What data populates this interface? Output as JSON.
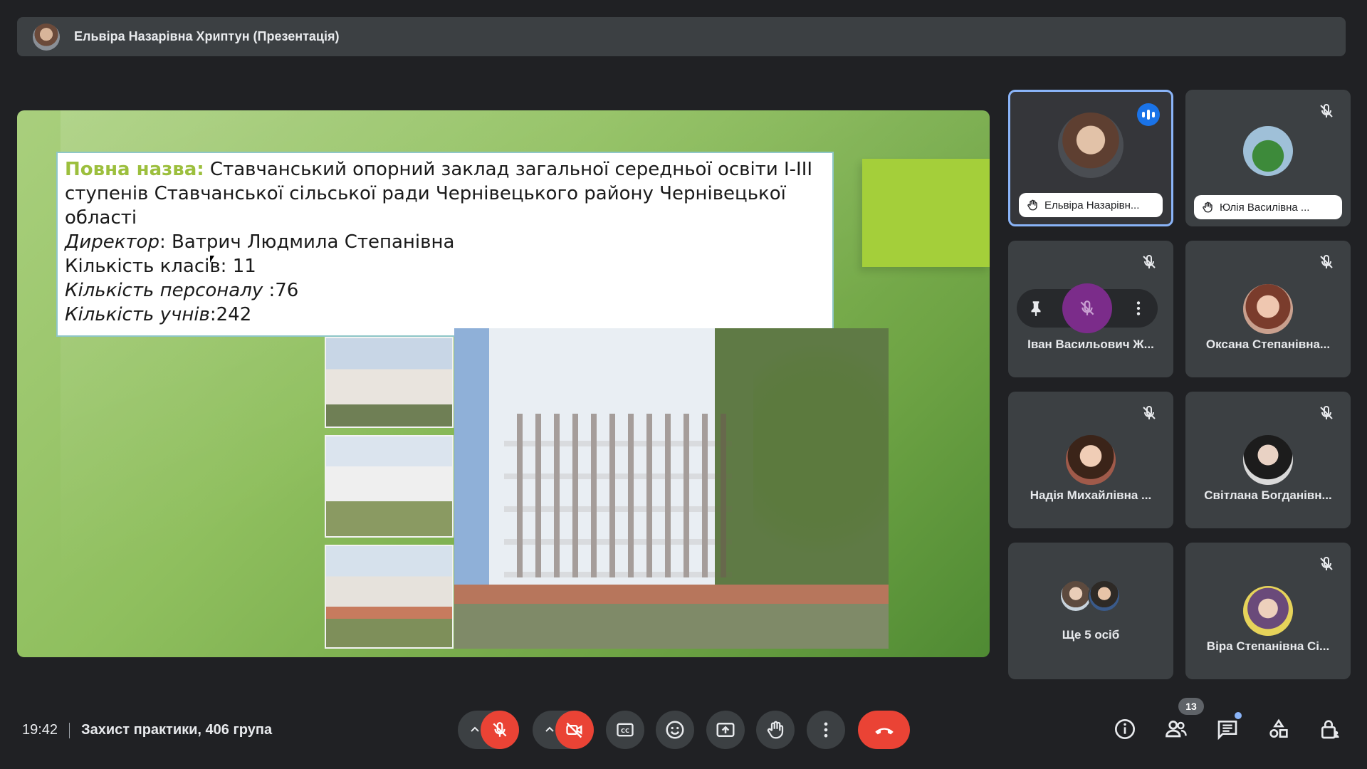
{
  "presenter": {
    "name": "Ельвіра Назарівна Хриптун (Презентація)"
  },
  "slide": {
    "full_name_label": "Повна назва:",
    "full_name_value": " Ставчанський опорний заклад загальної середньої освіти І-ІІІ ступенів Ставчанської сільської ради Чернівецького району Чернівецької області",
    "director_label": "Директор",
    "director_value": ": Ватрич Людмила Степанівна",
    "classes": "Кількість класів: 11",
    "staff_label": "Кількість персоналу",
    "staff_value": " :76",
    "students_label": "Кількість учнів",
    "students_value": ":242"
  },
  "participants": [
    {
      "name": "Ельвіра Назарівн...",
      "hand_raised": true,
      "speaking": true
    },
    {
      "name": "Юлія Василівна ...",
      "hand_raised": true,
      "muted": true
    },
    {
      "name": "Іван Васильович Ж...",
      "muted": true
    },
    {
      "name": "Оксана Степанівна...",
      "muted": true
    },
    {
      "name": "Надія Михайлівна ...",
      "muted": true
    },
    {
      "name": "Світлана Богданівн...",
      "muted": true
    },
    {
      "name": "Ще 5 осіб"
    },
    {
      "name": "Віра Степанівна Сі...",
      "muted": true
    }
  ],
  "meeting": {
    "time": "19:42",
    "title": "Захист практики, 406 група"
  },
  "participant_count": "13",
  "colors": {
    "accent_red": "#ea4335",
    "accent_blue": "#8ab4f8",
    "tile_bg": "#3c4043",
    "page_bg": "#202124",
    "slide_green": "#9cbf3d"
  }
}
